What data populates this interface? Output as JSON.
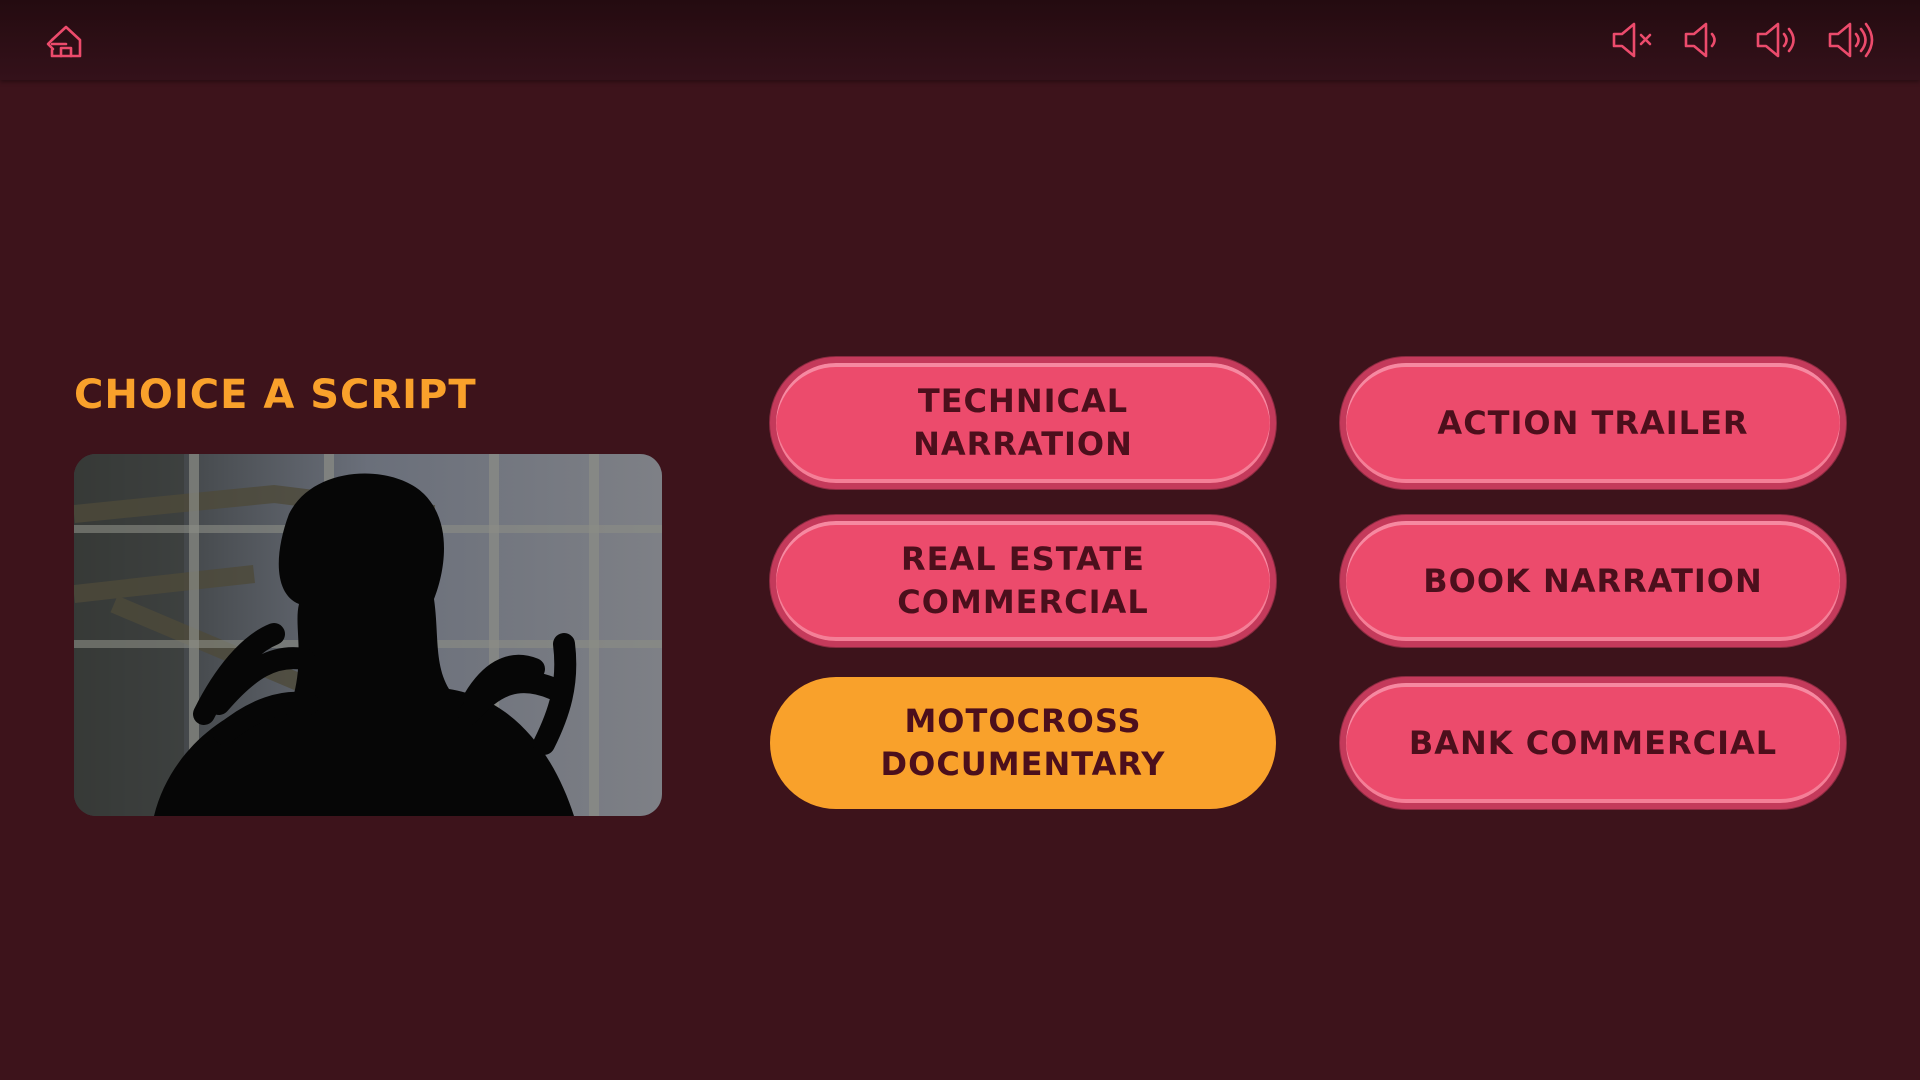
{
  "header": {
    "home_icon": "home-exit-icon",
    "volume_icons": [
      "volume-mute-icon",
      "volume-low-icon",
      "volume-medium-icon",
      "volume-high-icon"
    ]
  },
  "main": {
    "title": "CHOICE A SCRIPT",
    "scripts": [
      {
        "label": "TECHNICAL NARRATION",
        "selected": false
      },
      {
        "label": "ACTION TRAILER",
        "selected": false
      },
      {
        "label": "REAL ESTATE\nCOMMERCIAL",
        "selected": false
      },
      {
        "label": "BOOK NARRATION",
        "selected": false
      },
      {
        "label": "MOTOCROSS\nDOCUMENTARY",
        "selected": true
      },
      {
        "label": "BANK COMMERCIAL",
        "selected": false
      }
    ]
  },
  "colors": {
    "background": "#3d131b",
    "accent_pink": "#ec4b6c",
    "accent_orange": "#f9a12b",
    "button_text": "#4c0f1c"
  }
}
